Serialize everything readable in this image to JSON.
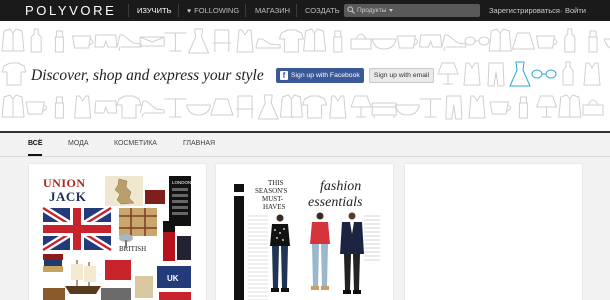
{
  "header": {
    "logo": "POLYVORE",
    "nav": [
      {
        "label": "ИЗУЧИТЬ",
        "active": true
      },
      {
        "label": "FOLLOWING",
        "active": false
      },
      {
        "label": "МАГАЗИН",
        "active": false
      },
      {
        "label": "СОЗДАТЬ",
        "active": false
      }
    ],
    "search_placeholder": "Продукты",
    "register": "Зарегистрироваться",
    "separator": "·",
    "login": "Войти"
  },
  "hero": {
    "tagline": "Discover, shop and express your style",
    "facebook_button": "Sign up with Facebook",
    "email_button": "Sign up with email",
    "accent_color": "#29a8d6"
  },
  "tabs": [
    {
      "label": "ВСЁ",
      "active": true
    },
    {
      "label": "МОДА",
      "active": false
    },
    {
      "label": "КОСМЕТИКА",
      "active": false
    },
    {
      "label": "ГЛАВНАЯ",
      "active": false
    }
  ],
  "cards": [
    {
      "headline_1": "UNION",
      "headline_2": "JACK",
      "label_city": "LONDON",
      "label_uk": "UK",
      "label_british": "BRITISH"
    },
    {
      "headline_1": "THIS",
      "headline_2": "SEASON'S",
      "headline_3": "MUST-",
      "headline_4": "HAVES",
      "script_1": "fashion",
      "script_2": "essentials"
    },
    {}
  ]
}
